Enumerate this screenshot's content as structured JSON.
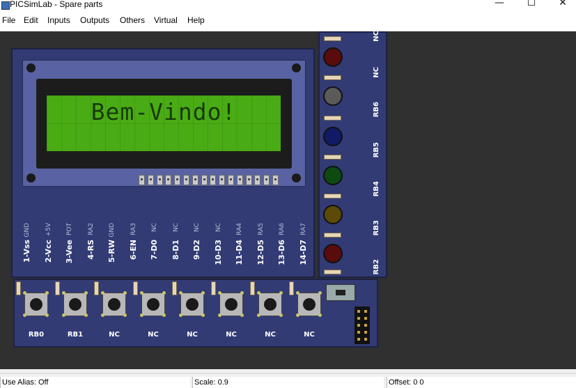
{
  "window": {
    "title": "PICSimLab - Spare parts",
    "minimize_glyph": "—",
    "maximize_glyph": "☐",
    "close_glyph": "✕"
  },
  "menu": {
    "file": "File",
    "edit": "Edit",
    "inputs": "Inputs",
    "outputs": "Outputs",
    "others": "Others",
    "virtual": "Virtual",
    "help": "Help"
  },
  "lcd": {
    "text": "Bem-Vindo!",
    "backlight_color": "#4aac14"
  },
  "lcd_pins": [
    {
      "pin": "1-Vss",
      "sig": "GND"
    },
    {
      "pin": "2-Vcc",
      "sig": "+5V"
    },
    {
      "pin": "3-Vee",
      "sig": "POT"
    },
    {
      "pin": "4-RS",
      "sig": "RA2"
    },
    {
      "pin": "5-RW",
      "sig": "GND"
    },
    {
      "pin": "6-EN",
      "sig": "RA3"
    },
    {
      "pin": "7-D0",
      "sig": "NC"
    },
    {
      "pin": "8-D1",
      "sig": "NC"
    },
    {
      "pin": "9-D2",
      "sig": "NC"
    },
    {
      "pin": "10-D3",
      "sig": "NC"
    },
    {
      "pin": "11-D4",
      "sig": "RA4"
    },
    {
      "pin": "12-D5",
      "sig": "RA5"
    },
    {
      "pin": "13-D6",
      "sig": "RA6"
    },
    {
      "pin": "14-D7",
      "sig": "RA7"
    }
  ],
  "leds": [
    {
      "label": "NC",
      "color": "#5a0c0c"
    },
    {
      "label": "NC",
      "color": "#5a5a5a"
    },
    {
      "label": "RB6",
      "color": "#101a66"
    },
    {
      "label": "RB5",
      "color": "#0c4a12"
    },
    {
      "label": "RB4",
      "color": "#5c4a08"
    },
    {
      "label": "RB3",
      "color": "#5a0c0c"
    },
    {
      "label": "RB2",
      "color": ""
    }
  ],
  "buttons": [
    "RB0",
    "RB1",
    "NC",
    "NC",
    "NC",
    "NC",
    "NC",
    "NC"
  ],
  "status": {
    "alias": "Use Alias: Off",
    "scale": "Scale: 0.9",
    "offset": "Offset:  0  0"
  },
  "colors": {
    "board": "#323b74",
    "canvas": "#303030"
  }
}
